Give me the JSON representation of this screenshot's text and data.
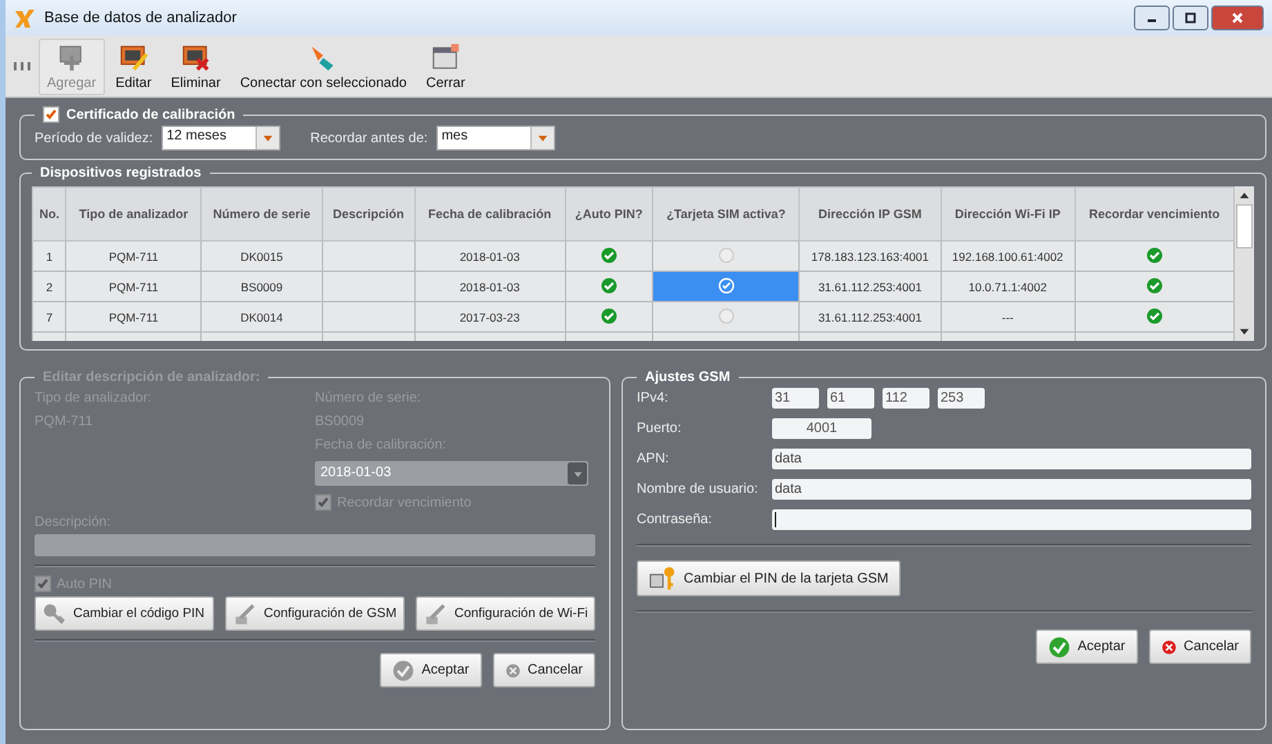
{
  "window": {
    "title": "Base de datos de analizador"
  },
  "toolbar": [
    {
      "label": "Agregar",
      "kind": "add",
      "disabled": true
    },
    {
      "label": "Editar",
      "kind": "edit",
      "disabled": false
    },
    {
      "label": "Eliminar",
      "kind": "delete",
      "disabled": false
    },
    {
      "label": "Conectar con seleccionado",
      "kind": "connect",
      "disabled": false
    },
    {
      "label": "Cerrar",
      "kind": "close",
      "disabled": false
    }
  ],
  "certificate": {
    "title": "Certificado de calibración",
    "checked": true,
    "validity_label": "Período de validez:",
    "validity_value": "12 meses",
    "remind_label": "Recordar antes de:",
    "remind_value": "mes"
  },
  "devices": {
    "title": "Dispositivos registrados",
    "columns": [
      "No.",
      "Tipo de analizador",
      "Número de serie",
      "Descripción",
      "Fecha de calibración",
      "¿Auto PIN?",
      "¿Tarjeta SIM activa?",
      "Dirección IP GSM",
      "Dirección Wi-Fi IP",
      "Recordar vencimiento"
    ],
    "rows": [
      {
        "no": "1",
        "type": "PQM-711",
        "serial": "DK0015",
        "date": "2018-01-03",
        "auto_pin": true,
        "sim_active": false,
        "gsm_ip": "178.183.123.163:4001",
        "wifi_ip": "192.168.100.61:4002",
        "remind": true,
        "selected": false
      },
      {
        "no": "2",
        "type": "PQM-711",
        "serial": "BS0009",
        "date": "2018-01-03",
        "auto_pin": true,
        "sim_active": true,
        "gsm_ip": "31.61.112.253:4001",
        "wifi_ip": "10.0.71.1:4002",
        "remind": true,
        "selected": true
      },
      {
        "no": "7",
        "type": "PQM-711",
        "serial": "DK0014",
        "date": "2017-03-23",
        "auto_pin": true,
        "sim_active": false,
        "gsm_ip": "31.61.112.253:4001",
        "wifi_ip": "---",
        "remind": true,
        "selected": false
      }
    ]
  },
  "edit_panel": {
    "title": "Editar descripción de analizador:",
    "disabled": true,
    "type_label": "Tipo de analizador:",
    "type_value": "PQM-711",
    "serial_label": "Número de serie:",
    "serial_value": "BS0009",
    "date_label": "Fecha de calibración:",
    "date_value": "2018-01-03",
    "remind": {
      "label": "Recordar vencimiento",
      "checked": true
    },
    "description_label": "Descripción:",
    "auto_pin": {
      "label": "Auto PIN",
      "checked": true
    },
    "buttons": [
      {
        "label": "Cambiar el código PIN",
        "kind": "key"
      },
      {
        "label": "Configuración de GSM",
        "kind": "tool"
      },
      {
        "label": "Configuración de Wi-Fi",
        "kind": "tool"
      }
    ],
    "ok": "Aceptar",
    "cancel": "Cancelar"
  },
  "gsm": {
    "title": "Ajustes GSM",
    "ipv4_label": "IPv4:",
    "ipv4": [
      "31",
      "61",
      "112",
      "253"
    ],
    "port_label": "Puerto:",
    "port": "4001",
    "fields": [
      {
        "label": "APN:",
        "value": "data"
      },
      {
        "label": "Nombre de usuario:",
        "value": "data"
      },
      {
        "label": "Contraseña:"
      }
    ],
    "pin_button": "Cambiar el PIN de la tarjeta GSM",
    "ok": "Aceptar",
    "cancel": "Cancelar"
  }
}
